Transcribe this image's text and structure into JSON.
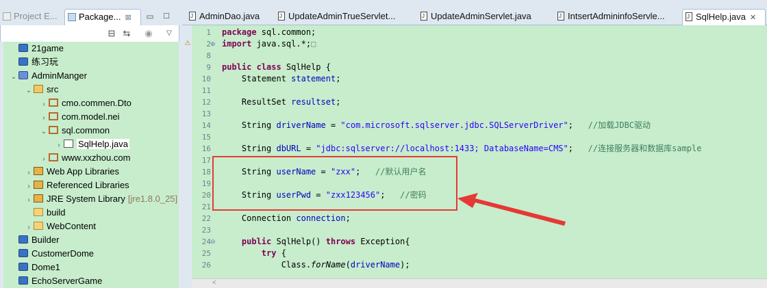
{
  "left_panel": {
    "tabs": [
      {
        "label": "Project E...",
        "active": false
      },
      {
        "label": "Package...",
        "active": true,
        "close": "⊠"
      }
    ],
    "tree": [
      {
        "label": "21game",
        "icon": "project-closed-icon",
        "indent": 0,
        "twisty": ""
      },
      {
        "label": "练习玩",
        "icon": "project-closed-icon",
        "indent": 0,
        "twisty": ""
      },
      {
        "label": "AdminManger",
        "icon": "project-open-icon",
        "indent": 0,
        "twisty": "⌄"
      },
      {
        "label": "src",
        "icon": "source-folder-icon",
        "indent": 1,
        "twisty": "⌄"
      },
      {
        "label": "cmo.commen.Dto",
        "icon": "package-icon",
        "indent": 2,
        "twisty": "›"
      },
      {
        "label": "com.model.nei",
        "icon": "package-icon",
        "indent": 2,
        "twisty": "›"
      },
      {
        "label": "sql.common",
        "icon": "package-icon",
        "indent": 2,
        "twisty": "⌄"
      },
      {
        "label": "SqlHelp.java",
        "icon": "java-file-icon",
        "indent": 3,
        "twisty": "›",
        "selected": true
      },
      {
        "label": "www.xxzhou.com",
        "icon": "package-icon",
        "indent": 2,
        "twisty": "›"
      },
      {
        "label": "Web App Libraries",
        "icon": "library-icon",
        "indent": 1,
        "twisty": "›"
      },
      {
        "label": "Referenced Libraries",
        "icon": "library-icon",
        "indent": 1,
        "twisty": "›"
      },
      {
        "label": "JRE System Library",
        "suffix": "[jre1.8.0_25]",
        "icon": "library-icon",
        "indent": 1,
        "twisty": "›"
      },
      {
        "label": "build",
        "icon": "folder-icon",
        "indent": 1,
        "twisty": ""
      },
      {
        "label": "WebContent",
        "icon": "folder-icon",
        "indent": 1,
        "twisty": "›"
      },
      {
        "label": "Builder",
        "icon": "project-closed-icon",
        "indent": 0,
        "twisty": ""
      },
      {
        "label": "CustomerDome",
        "icon": "project-closed-icon",
        "indent": 0,
        "twisty": ""
      },
      {
        "label": "Dome1",
        "icon": "project-closed-icon",
        "indent": 0,
        "twisty": ""
      },
      {
        "label": "EchoServerGame",
        "icon": "project-closed-icon",
        "indent": 0,
        "twisty": ""
      }
    ]
  },
  "editor": {
    "tabs": [
      {
        "label": "AdminDao.java",
        "active": false
      },
      {
        "label": "UpdateAdminTrueServlet...",
        "active": false
      },
      {
        "label": "UpdateAdminServlet.java",
        "active": false
      },
      {
        "label": "IntsertAdmininfoServle...",
        "active": false
      },
      {
        "label": "SqlHelp.java",
        "active": true,
        "close": "✕"
      }
    ],
    "lines": [
      {
        "num": "1",
        "fold": ""
      },
      {
        "num": "2",
        "fold": "⊕"
      },
      {
        "num": "8",
        "fold": ""
      },
      {
        "num": "9",
        "fold": ""
      },
      {
        "num": "10",
        "fold": ""
      },
      {
        "num": "11",
        "fold": ""
      },
      {
        "num": "12",
        "fold": ""
      },
      {
        "num": "13",
        "fold": ""
      },
      {
        "num": "14",
        "fold": ""
      },
      {
        "num": "15",
        "fold": ""
      },
      {
        "num": "16",
        "fold": ""
      },
      {
        "num": "17",
        "fold": ""
      },
      {
        "num": "18",
        "fold": ""
      },
      {
        "num": "19",
        "fold": ""
      },
      {
        "num": "20",
        "fold": ""
      },
      {
        "num": "21",
        "fold": ""
      },
      {
        "num": "22",
        "fold": ""
      },
      {
        "num": "23",
        "fold": ""
      },
      {
        "num": "24",
        "fold": "⊖"
      },
      {
        "num": "25",
        "fold": ""
      },
      {
        "num": "26",
        "fold": ""
      }
    ],
    "code": {
      "l1_kw": "package",
      "l1_rest": " sql.common;",
      "l2_kw": "import",
      "l2_rest": " java.sql.*;",
      "l2_box": "□",
      "l9_kw1": "public",
      "l9_kw2": "class",
      "l9_rest": " SqlHelp {",
      "l10_type": "    Statement ",
      "l10_fld": "statement",
      "l10_end": ";",
      "l12_type": "    ResultSet ",
      "l12_fld": "resultset",
      "l12_end": ";",
      "l14_type": "    String ",
      "l14_fld": "driverName",
      "l14_eq": " = ",
      "l14_str": "\"com.microsoft.sqlserver.jdbc.SQLServerDriver\"",
      "l14_end": ";",
      "l14_cmt": "   //加载JDBC驱动",
      "l16_type": "    String ",
      "l16_fld": "dbURL",
      "l16_eq": " = ",
      "l16_str": "\"jdbc:sqlserver://localhost:1433; DatabaseName=CMS\"",
      "l16_end": ";",
      "l16_cmt": "   //连接服务器和数据库sample",
      "l18_type": "    String ",
      "l18_fld": "userName",
      "l18_eq": " = ",
      "l18_str": "\"zxx\"",
      "l18_end": ";",
      "l18_cmt": "   //默认用户名",
      "l20_type": "    String ",
      "l20_fld": "userPwd",
      "l20_eq": " = ",
      "l20_str": "\"zxx123456\"",
      "l20_end": ";",
      "l20_cmt": "   //密码",
      "l22_type": "    Connection ",
      "l22_fld": "connection",
      "l22_end": ";",
      "l24_kw1": "public",
      "l24_mid": " SqlHelp() ",
      "l24_kw2": "throws",
      "l24_rest": " Exception{",
      "l25_kw": "try",
      "l25_rest": " {",
      "l26_a": "            Class.",
      "l26_m": "forName",
      "l26_b": "(",
      "l26_fld": "driverName",
      "l26_c": ");"
    }
  },
  "colors": {
    "editor_bg": "#c7edcc",
    "keyword": "#7f0055",
    "field": "#0000c0",
    "string": "#2a00ff",
    "comment": "#3f7f5f",
    "annotation": "#e53935"
  }
}
